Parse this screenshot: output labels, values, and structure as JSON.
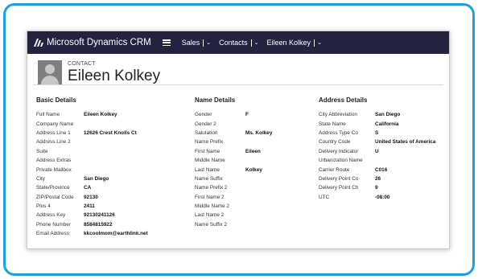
{
  "topbar": {
    "app_name": "Microsoft Dynamics CRM",
    "nav": [
      {
        "label": "Sales"
      },
      {
        "label": "Contacts"
      },
      {
        "label": "Eileen Kolkey"
      }
    ]
  },
  "record": {
    "entity_label": "CONTACT",
    "full_name": "Eileen Kolkey"
  },
  "sections": [
    {
      "title": "Basic Details",
      "rows": [
        {
          "label": "Full Name",
          "value": "Eileen Kolkey"
        },
        {
          "label": "Company Name",
          "value": ""
        },
        {
          "label": "Address Line 1",
          "value": "12626 Crest Knolls Ct"
        },
        {
          "label": "Address Line 2",
          "value": ""
        },
        {
          "label": "Suite",
          "value": ""
        },
        {
          "label": "Address Extras",
          "value": ""
        },
        {
          "label": "Private Mailbox",
          "value": ""
        },
        {
          "label": "City",
          "value": "San Diego"
        },
        {
          "label": "State/Province",
          "value": "CA"
        },
        {
          "label": "ZIP/Postal Code",
          "value": "92130"
        },
        {
          "label": "Plus 4",
          "value": "2411"
        },
        {
          "label": "Address Key",
          "value": "92130241126"
        },
        {
          "label": "Phone Number",
          "value": "8584815922"
        },
        {
          "label": "Email Address",
          "value": "kkcoolmom@earthlink.net"
        }
      ]
    },
    {
      "title": "Name Details",
      "rows": [
        {
          "label": "Gender",
          "value": "F"
        },
        {
          "label": "Gender 2",
          "value": ""
        },
        {
          "label": "Salutation",
          "value": "Ms. Kolkey"
        },
        {
          "label": "Name Prefix",
          "value": ""
        },
        {
          "label": "First Name",
          "value": "Eileen"
        },
        {
          "label": "Middle Name",
          "value": ""
        },
        {
          "label": "Last Name",
          "value": "Kolkey"
        },
        {
          "label": "Name Suffix",
          "value": ""
        },
        {
          "label": "Name Prefix 2",
          "value": ""
        },
        {
          "label": "First Name 2",
          "value": ""
        },
        {
          "label": "Middle Name 2",
          "value": ""
        },
        {
          "label": "Last Name 2",
          "value": ""
        },
        {
          "label": "Name Suffix 2",
          "value": ""
        }
      ]
    },
    {
      "title": "Address Details",
      "rows": [
        {
          "label": "City Abbreviation",
          "value": "San Diego"
        },
        {
          "label": "State Name",
          "value": "California"
        },
        {
          "label": "Address Type Co",
          "value": "S"
        },
        {
          "label": "Country Code",
          "value": "United States of America"
        },
        {
          "label": "Delivery Indicator",
          "value": "U"
        },
        {
          "label": "Urbanization Name",
          "value": ""
        },
        {
          "label": "Carrier Route",
          "value": "C016"
        },
        {
          "label": "Delivery Point Co",
          "value": "26"
        },
        {
          "label": "Delivery Point Ch",
          "value": "9"
        },
        {
          "label": "UTC",
          "value": "-08:00"
        }
      ]
    }
  ]
}
